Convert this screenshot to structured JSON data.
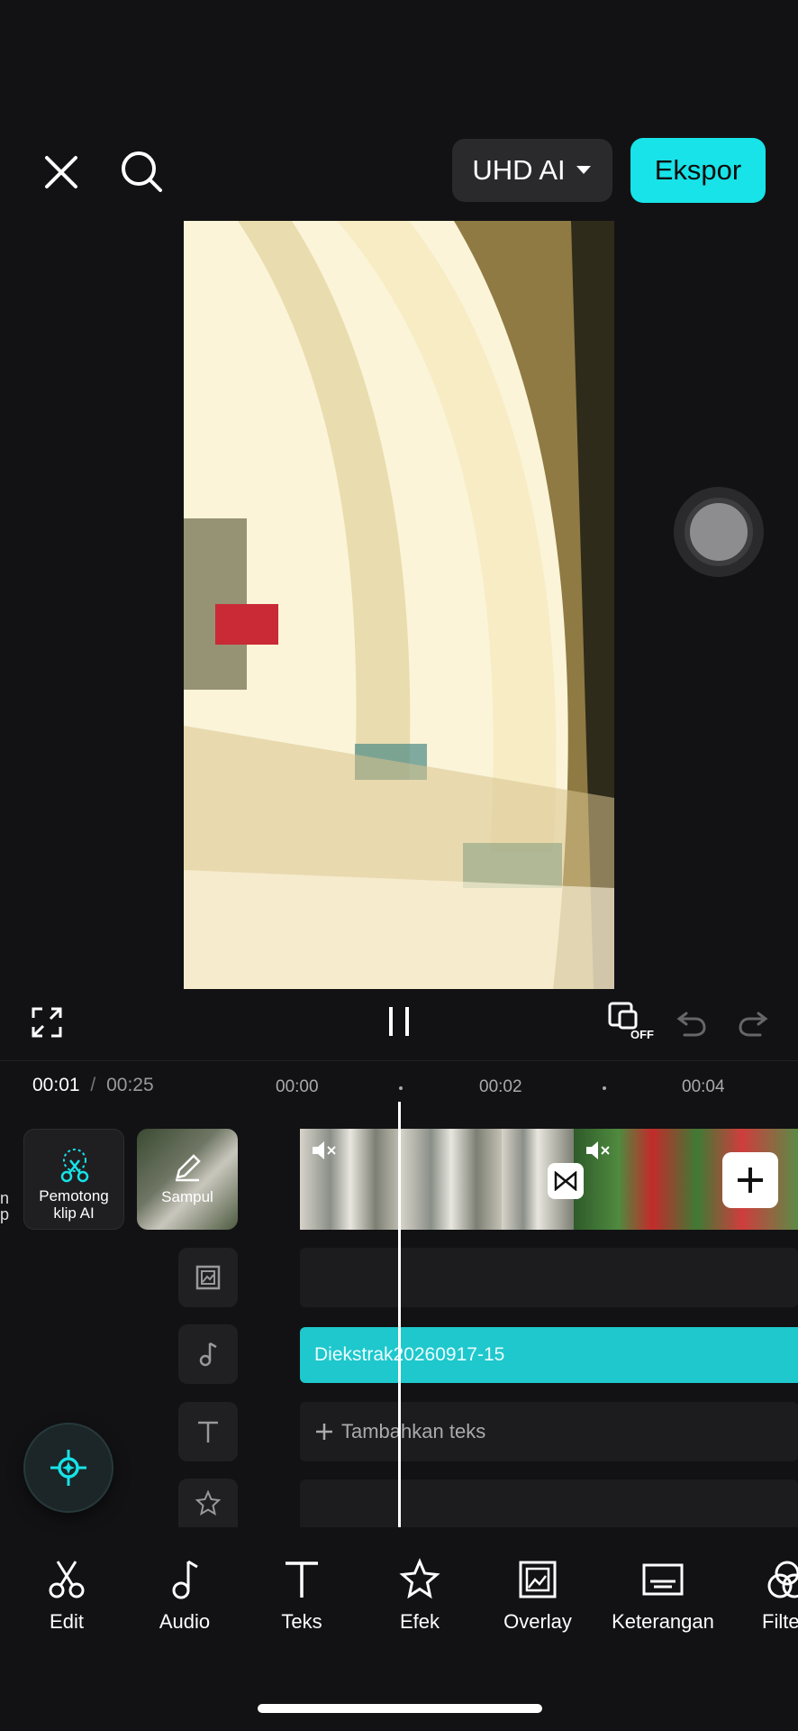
{
  "header": {
    "quality_label": "UHD AI",
    "export_label": "Ekspor"
  },
  "timecode": {
    "current": "00:01",
    "separator": "/",
    "total": "00:25"
  },
  "ruler": [
    "00:00",
    "00:02",
    "00:04"
  ],
  "clip_tools": {
    "ai_cut_label": "Pemotong klip AI",
    "cover_label": "Sampul",
    "left_cut_label_1": "n",
    "left_cut_label_2": "p"
  },
  "tracks": {
    "audio_clip_name": "Diekstrak20260917-15",
    "add_text_label": "Tambahkan teks"
  },
  "preview_controls": {
    "off_badge": "OFF"
  },
  "toolbar": [
    {
      "label": "Edit",
      "icon": "scissors-icon"
    },
    {
      "label": "Audio",
      "icon": "music-note-icon"
    },
    {
      "label": "Teks",
      "icon": "text-icon"
    },
    {
      "label": "Efek",
      "icon": "star-effect-icon"
    },
    {
      "label": "Overlay",
      "icon": "overlay-icon"
    },
    {
      "label": "Keterangan",
      "icon": "caption-icon"
    },
    {
      "label": "Filte",
      "icon": "filter-icon"
    }
  ],
  "colors": {
    "accent": "#17e3e8",
    "background": "#121214",
    "audio_track": "#1ec8cc"
  }
}
